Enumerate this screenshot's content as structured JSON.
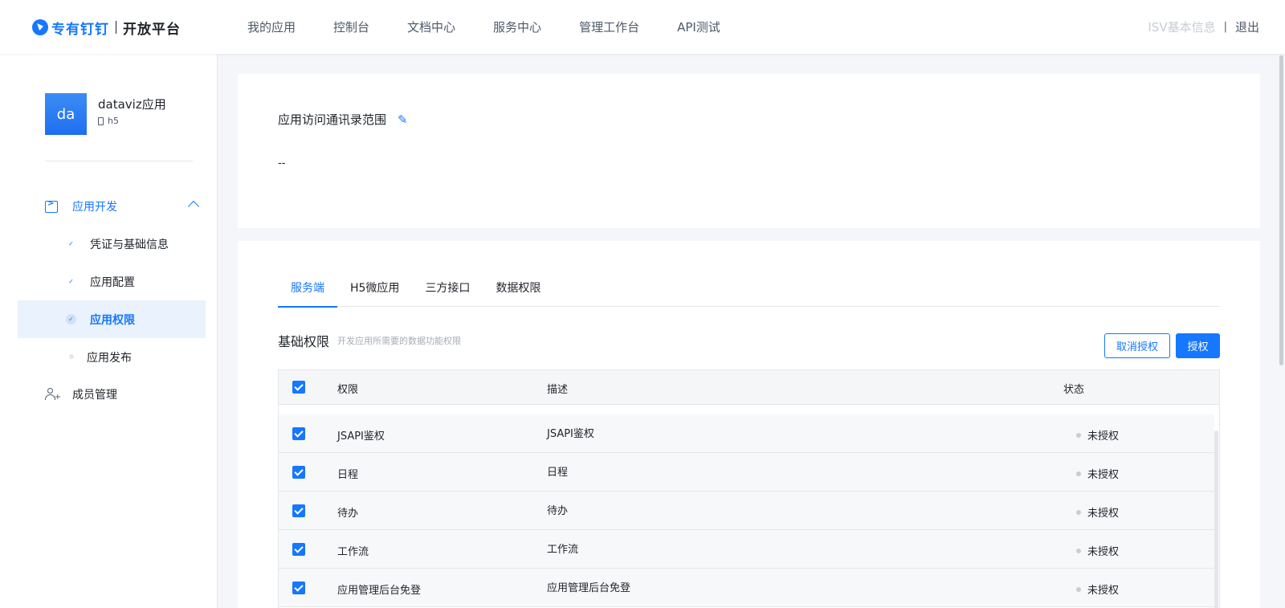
{
  "topnav": {
    "brand": "专有钉钉",
    "subtitle": "开放平台",
    "links": [
      "我的应用",
      "控制台",
      "文档中心",
      "服务中心",
      "管理工作台",
      "API测试"
    ],
    "isv": "ISV基本信息",
    "divider": "|",
    "logout": "退出"
  },
  "sidebar": {
    "avatar_text": "da",
    "app_name": "dataviz应用",
    "app_type": "h5",
    "group_label": "应用开发",
    "sub_items": [
      "凭证与基础信息",
      "应用配置",
      "应用权限",
      "应用发布"
    ],
    "member_label": "成员管理"
  },
  "scope": {
    "title": "应用访问通讯录范围",
    "value": "--"
  },
  "permissions": {
    "tabs": [
      "服务端",
      "H5微应用",
      "三方接口",
      "数据权限"
    ],
    "title": "基础权限",
    "desc": "开发应用所需要的数据功能权限",
    "cancel_label": "取消授权",
    "auth_label": "授权",
    "columns": [
      "权限",
      "描述",
      "状态"
    ],
    "rows": [
      {
        "name": "JSAPI鉴权",
        "desc": "JSAPI鉴权",
        "status": "未授权"
      },
      {
        "name": "日程",
        "desc": "日程",
        "status": "未授权"
      },
      {
        "name": "待办",
        "desc": "待办",
        "status": "未授权"
      },
      {
        "name": "工作流",
        "desc": "工作流",
        "status": "未授权"
      },
      {
        "name": "应用管理后台免登",
        "desc": "应用管理后台免登",
        "status": "未授权"
      }
    ]
  },
  "colors": {
    "accent": "#1677ff",
    "status_dot": "#c9cdd4"
  }
}
